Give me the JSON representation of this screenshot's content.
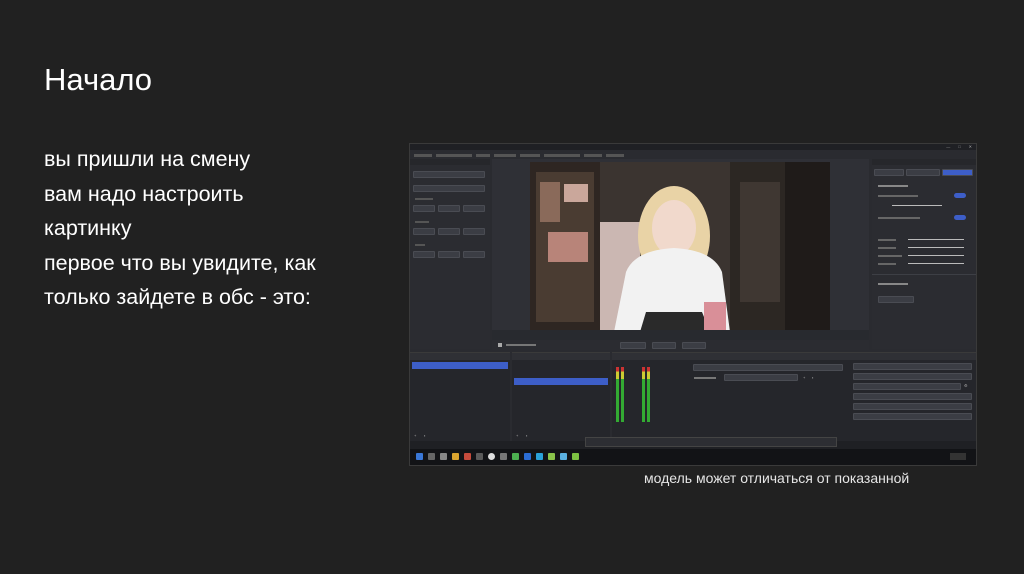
{
  "slide": {
    "title": "Начало",
    "body_lines": [
      "вы пришли на смену",
      "вам надо настроить",
      "картинку",
      "первое что вы увидите, как",
      "только зайдете в обс - это:"
    ],
    "caption": "модель может отличаться от показанной"
  },
  "colors": {
    "background": "#212121",
    "obs_panel": "#2b2c31",
    "obs_accent": "#3d5ec8"
  },
  "icons": [
    "obs-icon",
    "windows-start-icon",
    "search-icon",
    "close-icon",
    "minimize-icon",
    "maximize-icon",
    "gear-icon",
    "plus-icon",
    "trash-icon"
  ]
}
